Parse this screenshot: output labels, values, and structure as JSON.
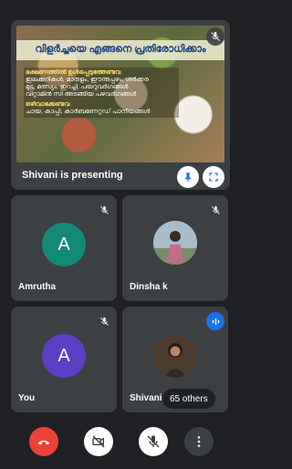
{
  "presentation": {
    "slide_title": "വിളർച്ചയെ എങ്ങനെ പ്രതിരോധിക്കാം",
    "slide_lines": [
      {
        "text": "ഭക്ഷണത്തിൽ ഉൾപ്പെടുത്തേണ്ടവ",
        "heading": true
      },
      {
        "text": "ഇലക്കറികൾ, മാതളം, ഈന്തപ്പഴം, ശർക്കര",
        "heading": false
      },
      {
        "text": "മുട്ട, മത്സ്യം, ഇറച്ചി, പയറുവർഗങ്ങൾ",
        "heading": false
      },
      {
        "text": "വിറ്റാമിൻ സി അടങ്ങിയ പഴവർഗങ്ങൾ",
        "heading": false
      },
      {
        "text": "ഒഴിവാക്കേണ്ടവ",
        "heading": true
      },
      {
        "text": "ചായ, കാപ്പി, കാർബണേറ്റഡ് പാനീയങ്ങൾ",
        "heading": false
      }
    ],
    "presenter_label": "Shivani is presenting"
  },
  "participants": [
    {
      "name": "Amrutha",
      "initial": "A",
      "avatar_color": "#138a76"
    },
    {
      "name": "Dinsha k",
      "initial": "",
      "avatar_color": "#7b9bb0"
    },
    {
      "name": "You",
      "initial": "A",
      "avatar_color": "#5b3fc4"
    },
    {
      "name": "Shivani",
      "initial": "",
      "avatar_color": "#6d5a4a"
    }
  ],
  "others_count_label": "65 others",
  "icons": {
    "pin": "pin-icon",
    "fullscreen": "fullscreen-icon",
    "mic_off": "mic-off-icon",
    "speaking": "audio-bars-icon",
    "end_call": "phone-hangup-icon",
    "camera_off": "camera-off-icon",
    "more": "more-vert-icon"
  },
  "colors": {
    "end_call": "#ea4335",
    "speaking_badge": "#1a73e8",
    "tile_bg": "#3c4043"
  }
}
